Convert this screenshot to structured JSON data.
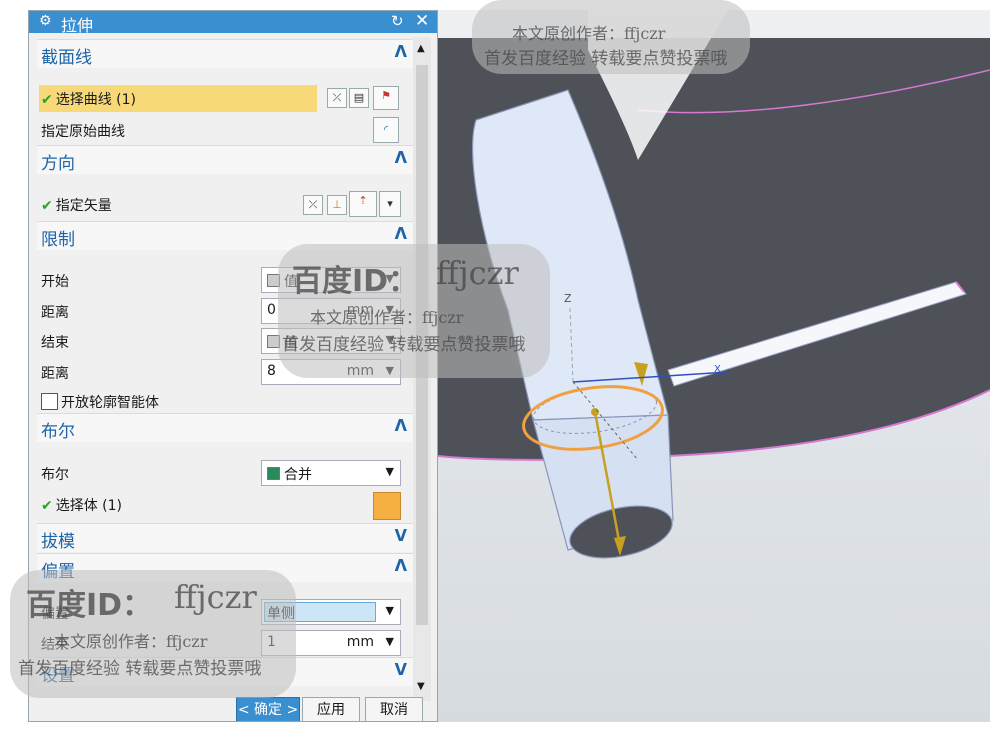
{
  "dialog": {
    "title": "拉伸",
    "sections": {
      "section_curve": {
        "title": "截面线"
      },
      "direction": {
        "title": "方向"
      },
      "limits": {
        "title": "限制"
      },
      "boolean": {
        "title": "布尔"
      },
      "draft": {
        "title": "拔模"
      },
      "offset": {
        "title": "偏置"
      },
      "settings": {
        "title": "设置"
      }
    },
    "select_curve": "选择曲线 (1)",
    "specify_original_curve": "指定原始曲线",
    "specify_vector": "指定矢量",
    "start_label": "开始",
    "start_value": "值",
    "distance_label_1": "距离",
    "distance_value_1": "0",
    "end_label": "结束",
    "end_value": "值",
    "distance_label_2": "距离",
    "distance_value_2": "8",
    "unit": "mm",
    "open_profile_label": "开放轮廓智能体",
    "boolean_label": "布尔",
    "boolean_value": "合并",
    "select_body": "选择体 (1)",
    "offset_label": "偏置",
    "offset_value": "单侧",
    "offset_end_label": "结束",
    "offset_end_value": "1",
    "ok_button": "< 确定 >",
    "apply_button": "应用",
    "cancel_button": "取消"
  },
  "viewport": {
    "axis_x": "X",
    "axis_z": "Z"
  },
  "watermark": {
    "id_text": "百度ID：",
    "username": "ffjczr",
    "author_line": "本文原创作者：ffjczr",
    "promo_line": "首发百度经验 转载要点赞投票哦"
  },
  "colors": {
    "title_bar": "#3a8fd0",
    "section_title": "#1e64a8",
    "highlight": "#f8d97a",
    "check": "#2aa02a",
    "ring": "#f0a040",
    "cylinder": "#dde8f8",
    "disc": "#4e5258"
  }
}
